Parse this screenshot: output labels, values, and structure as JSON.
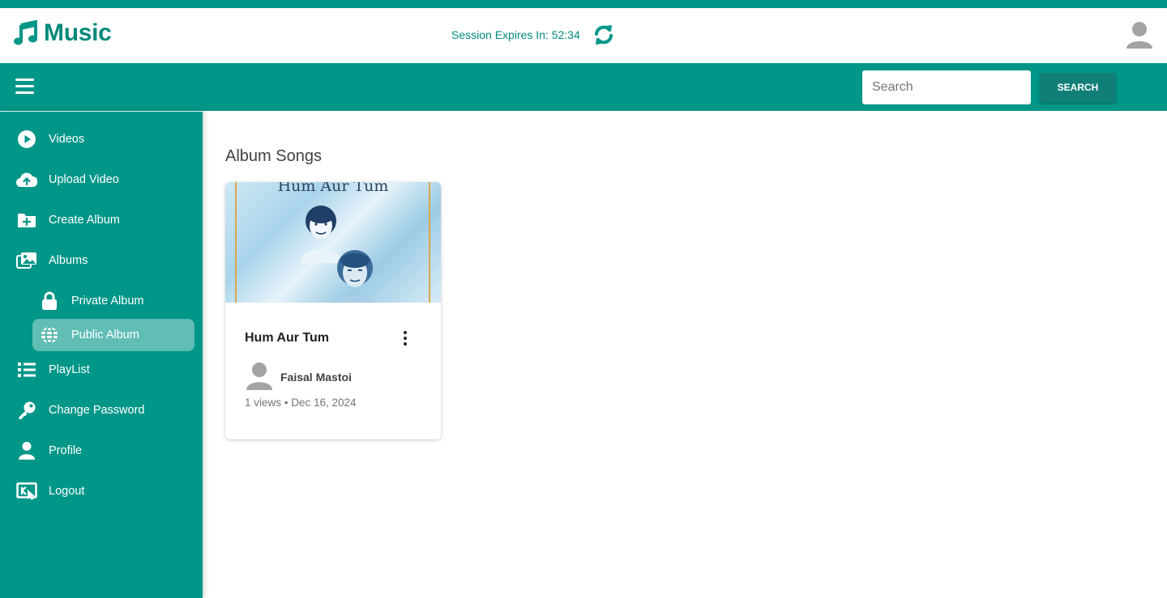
{
  "header": {
    "app_name": "Music",
    "session_text": "Session Expires In: 52:34"
  },
  "navbar": {
    "search_placeholder": "Search",
    "search_button": "SEARCH"
  },
  "sidebar": {
    "items": [
      {
        "label": "Videos",
        "icon": "play-circle-icon"
      },
      {
        "label": "Upload Video",
        "icon": "cloud-upload-icon"
      },
      {
        "label": "Create Album",
        "icon": "folder-plus-icon"
      },
      {
        "label": "Albums",
        "icon": "images-icon"
      },
      {
        "label": "Private Album",
        "icon": "lock-icon"
      },
      {
        "label": "Public Album",
        "icon": "globe-icon",
        "active": true
      },
      {
        "label": "PlayList",
        "icon": "list-icon"
      },
      {
        "label": "Change Password",
        "icon": "key-icon"
      },
      {
        "label": "Profile",
        "icon": "user-icon"
      },
      {
        "label": "Logout",
        "icon": "logout-icon"
      }
    ]
  },
  "main": {
    "title": "Album Songs",
    "songs": [
      {
        "thumbnail_title": "Hum Aur Tum",
        "title": "Hum Aur Tum",
        "author": "Faisal Mastoi",
        "meta": "1 views • Dec 16, 2024"
      }
    ]
  },
  "colors": {
    "primary": "#009688",
    "primary_dark": "#00897b",
    "button": "#117f78"
  }
}
